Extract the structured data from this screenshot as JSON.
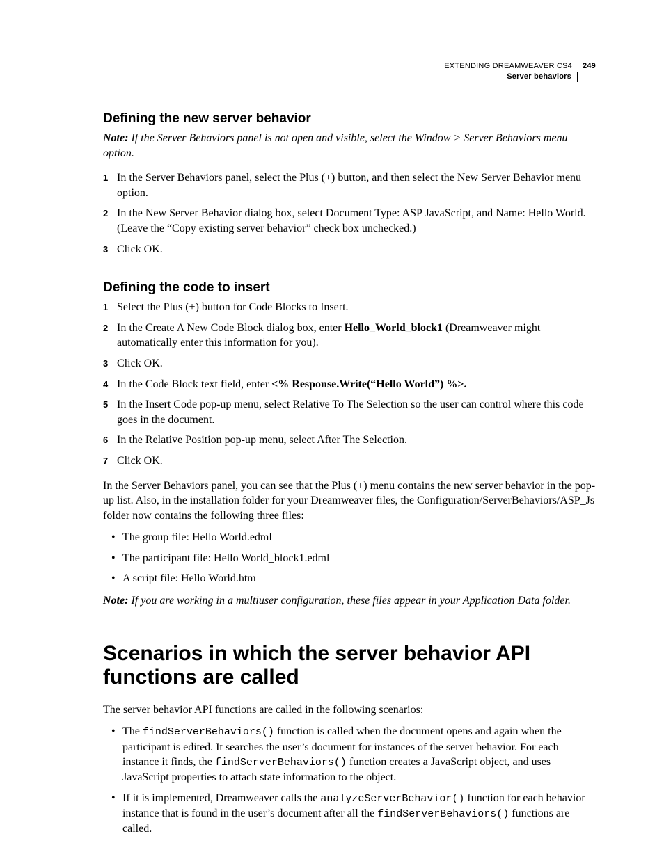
{
  "header": {
    "title": "EXTENDING DREAMWEAVER CS4",
    "page": "249",
    "section": "Server behaviors"
  },
  "s1": {
    "heading": "Defining the new server behavior",
    "note_label": "Note: ",
    "note_text": "If the Server Behaviors panel is not open and visible, select the Window > Server Behaviors menu option.",
    "step1": "In the Server Behaviors panel, select the Plus (+) button, and then select the New Server Behavior menu option.",
    "step2": "In the New Server Behavior dialog box, select Document Type: ASP JavaScript, and Name: Hello World. (Leave the “Copy existing server behavior” check box unchecked.)",
    "step3": "Click OK."
  },
  "s2": {
    "heading": "Defining the code to insert",
    "step1": "Select the Plus (+) button for Code Blocks to Insert.",
    "step2a": "In the Create A New Code Block dialog box, enter ",
    "step2b": "Hello_World_block1",
    "step2c": " (Dreamweaver might automatically enter this information for you).",
    "step3": "Click OK.",
    "step4a": "In the Code Block text field, enter ",
    "step4b": "<% Response.Write(“Hello World”) %>.",
    "step5": "In the Insert Code pop-up menu, select Relative To The Selection so the user can control where this code goes in the document.",
    "step6": "In the Relative Position pop-up menu, select After The Selection.",
    "step7": "Click OK.",
    "para": "In the Server Behaviors panel, you can see that the Plus (+) menu contains the new server behavior in the pop-up list. Also, in the installation folder for your Dreamweaver files, the Configuration/ServerBehaviors/ASP_Js folder now contains the following three files:",
    "b1": "The group file: Hello World.edml",
    "b2": "The participant file: Hello World_block1.edml",
    "b3": "A script file: Hello World.htm",
    "note2_label": "Note: ",
    "note2_text": "If you are working in a multiuser configuration, these files appear in your Application Data folder."
  },
  "s3": {
    "heading": "Scenarios in which the server behavior API functions are called",
    "intro": "The server behavior API functions are called in the following scenarios:",
    "b1a": "The ",
    "b1b": "findServerBehaviors()",
    "b1c": " function is called when the document opens and again when the participant is edited. It searches the user’s document for instances of the server behavior. For each instance it finds, the ",
    "b1d": "findServerBehaviors()",
    "b1e": " function creates a JavaScript object, and uses JavaScript properties to attach state information to the object.",
    "b2a": "If it is implemented, Dreamweaver calls the ",
    "b2b": "analyzeServerBehavior()",
    "b2c": " function for each behavior instance that is found in the user’s document after all the ",
    "b2d": "findServerBehaviors()",
    "b2e": " functions are called."
  }
}
